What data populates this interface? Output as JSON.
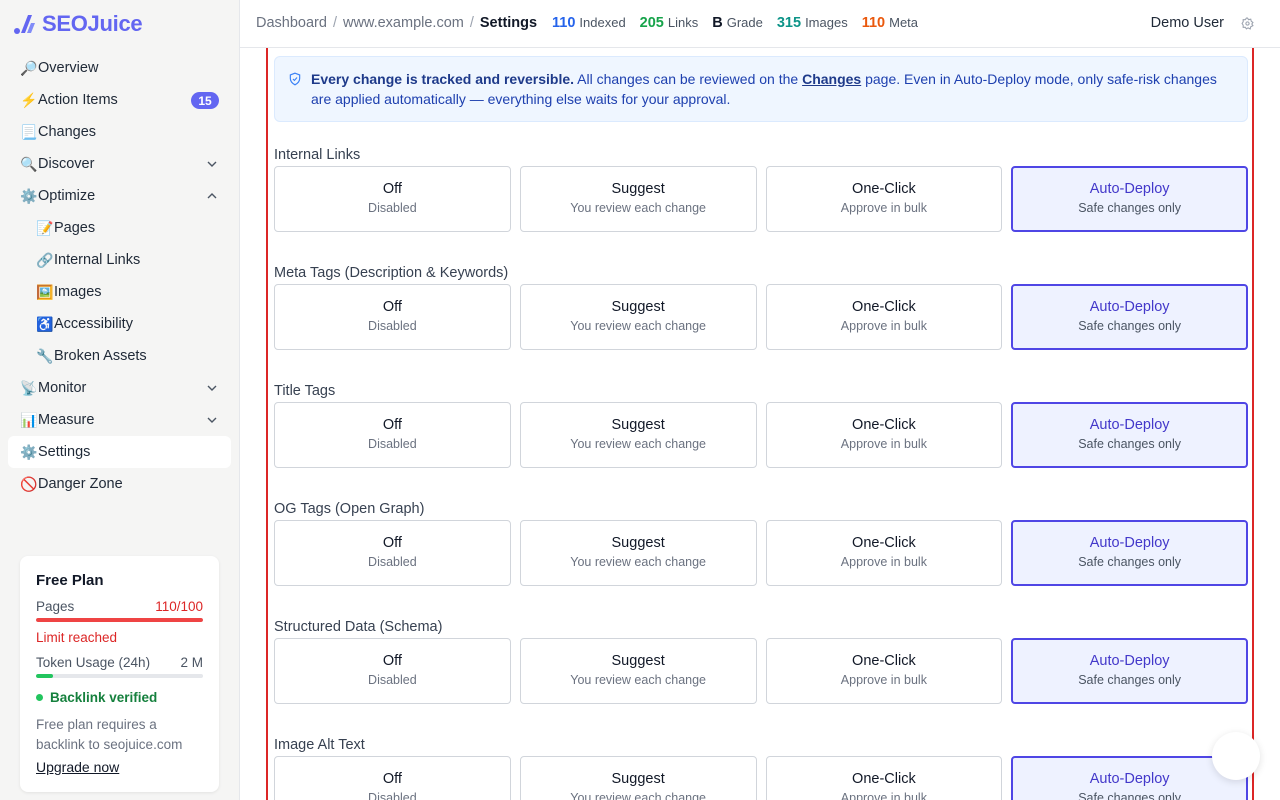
{
  "app": {
    "name": "SEOJuice",
    "brand_color": "#6366f1"
  },
  "sidebar": {
    "items": [
      {
        "emoji": "🔎",
        "label": "Overview"
      },
      {
        "emoji": "⚡",
        "label": "Action Items",
        "badge": "15"
      },
      {
        "emoji": "📃",
        "label": "Changes"
      },
      {
        "emoji": "🔍",
        "label": "Discover",
        "chevron": "down"
      },
      {
        "emoji": "⚙️",
        "label": "Optimize",
        "chevron": "up"
      },
      {
        "emoji": "📝",
        "label": "Pages",
        "sub": true
      },
      {
        "emoji": "🔗",
        "label": "Internal Links",
        "sub": true
      },
      {
        "emoji": "🖼️",
        "label": "Images",
        "sub": true
      },
      {
        "emoji": "♿",
        "label": "Accessibility",
        "sub": true
      },
      {
        "emoji": "🔧",
        "label": "Broken Assets",
        "sub": true
      },
      {
        "emoji": "📡",
        "label": "Monitor",
        "chevron": "down"
      },
      {
        "emoji": "📊",
        "label": "Measure",
        "chevron": "down"
      },
      {
        "emoji": "⚙️",
        "label": "Settings",
        "active": true
      },
      {
        "emoji": "🚫",
        "label": "Danger Zone"
      }
    ],
    "plan": {
      "title": "Free Plan",
      "pages_label": "Pages",
      "pages_value": "110/100",
      "pages_fill": 1.0,
      "limit_text": "Limit reached",
      "token_label": "Token Usage (24h)",
      "token_value": "2 M",
      "token_fill": 0.1,
      "verified_text": "Backlink verified",
      "note": "Free plan requires a backlink to seojuice.com",
      "upgrade_label": "Upgrade now"
    }
  },
  "header": {
    "breadcrumb": [
      "Dashboard",
      "www.example.com",
      "Settings"
    ],
    "stats": [
      {
        "value": "110",
        "label": "Indexed",
        "color": "#2563eb"
      },
      {
        "value": "205",
        "label": "Links",
        "color": "#16a34a"
      },
      {
        "value": "B",
        "label": "Grade",
        "color": "#111827"
      },
      {
        "value": "315",
        "label": "Images",
        "color": "#0d9488"
      },
      {
        "value": "110",
        "label": "Meta",
        "color": "#ea580c"
      }
    ],
    "user": "Demo User"
  },
  "notice": {
    "bold": "Every change is tracked and reversible.",
    "text1": " All changes can be reviewed on the ",
    "link": "Changes",
    "text2": " page. Even in Auto-Deploy mode, only safe-risk changes are applied automatically — everything else waits for your approval."
  },
  "option_labels": [
    {
      "title": "Off",
      "subtitle": "Disabled"
    },
    {
      "title": "Suggest",
      "subtitle": "You review each change"
    },
    {
      "title": "One-Click",
      "subtitle": "Approve in bulk"
    },
    {
      "title": "Auto-Deploy",
      "subtitle": "Safe changes only"
    }
  ],
  "sections": [
    {
      "title": "Internal Links",
      "selected": "Auto-Deploy"
    },
    {
      "title": "Meta Tags (Description & Keywords)",
      "selected": "Auto-Deploy"
    },
    {
      "title": "Title Tags",
      "selected": "Auto-Deploy"
    },
    {
      "title": "OG Tags (Open Graph)",
      "selected": "Auto-Deploy"
    },
    {
      "title": "Structured Data (Schema)",
      "selected": "Auto-Deploy"
    },
    {
      "title": "Image Alt Text",
      "selected": "Auto-Deploy"
    }
  ]
}
